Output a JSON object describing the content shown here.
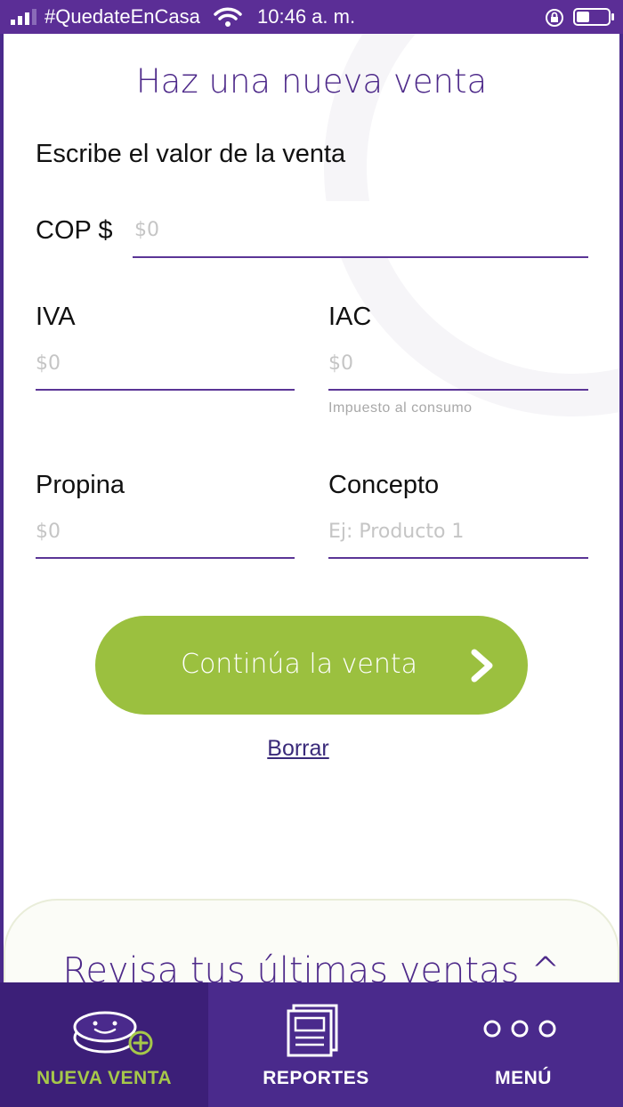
{
  "status_bar": {
    "carrier": "#QuedateEnCasa",
    "time": "10:46 a. m."
  },
  "page": {
    "title": "Haz una nueva venta",
    "subtitle": "Escribe el valor de la venta"
  },
  "form": {
    "cop_label": "COP $",
    "cop_placeholder": "$0",
    "iva_label": "IVA",
    "iva_placeholder": "$0",
    "iac_label": "IAC",
    "iac_placeholder": "$0",
    "iac_helper": "Impuesto al consumo",
    "propina_label": "Propina",
    "propina_placeholder": "$0",
    "concepto_label": "Concepto",
    "concepto_placeholder": "Ej: Producto 1"
  },
  "actions": {
    "continue_label": "Continúa la venta",
    "clear_label": "Borrar"
  },
  "recent": {
    "label": "Revisa tus últimas ventas ^"
  },
  "tabbar": {
    "tabs": [
      {
        "label": "NUEVA VENTA",
        "icon": "coin-plus-icon",
        "active": true
      },
      {
        "label": "REPORTES",
        "icon": "report-icon",
        "active": false
      },
      {
        "label": "MENÚ",
        "icon": "more-dots-icon",
        "active": false
      }
    ]
  },
  "colors": {
    "primary_purple": "#4e2a8a",
    "accent_green": "#9bc03f",
    "active_tab_label": "#a6c84a"
  }
}
